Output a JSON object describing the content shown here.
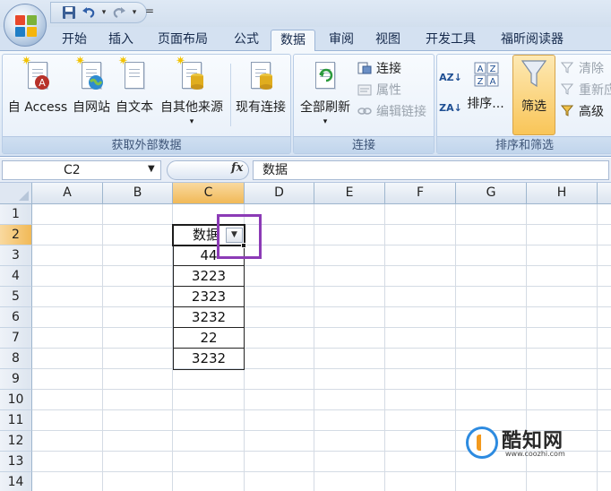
{
  "title_bar": {
    "qat_icons": [
      "save-icon",
      "undo-icon",
      "redo-icon"
    ],
    "qat_customize": "="
  },
  "tabs": [
    {
      "label": "开始"
    },
    {
      "label": "插入"
    },
    {
      "label": "页面布局"
    },
    {
      "label": "公式"
    },
    {
      "label": "数据",
      "active": true
    },
    {
      "label": "审阅"
    },
    {
      "label": "视图"
    },
    {
      "label": "开发工具"
    },
    {
      "label": "福昕阅读器"
    }
  ],
  "ribbon": {
    "external_data": {
      "label": "获取外部数据",
      "buttons": [
        "自 Access",
        "自网站",
        "自文本",
        "自其他来源",
        "现有连接"
      ]
    },
    "connections": {
      "label": "连接",
      "refresh_all": "全部刷新",
      "connections": "连接",
      "properties": "属性",
      "edit_links": "编辑链接"
    },
    "sort_filter": {
      "label": "排序和筛选",
      "sort_asc_icon": "AZ↓",
      "sort_desc_icon": "ZA↓",
      "sort": "排序...",
      "filter": "筛选",
      "clear": "清除",
      "reapply": "重新应",
      "advanced": "高级"
    }
  },
  "formula_bar": {
    "name_box": "C2",
    "fx": "fx",
    "formula": "数据"
  },
  "grid": {
    "columns": [
      "A",
      "B",
      "C",
      "D",
      "E",
      "F",
      "G",
      "H"
    ],
    "selected_column": "C",
    "rows": [
      "1",
      "2",
      "3",
      "4",
      "5",
      "6",
      "7",
      "8",
      "9",
      "10",
      "11",
      "12",
      "13",
      "14"
    ],
    "selected_row": "2",
    "column_c": [
      "",
      "数据",
      "44",
      "3223",
      "2323",
      "3232",
      "22",
      "3232"
    ]
  },
  "watermark": {
    "title": "酷知网",
    "url": "www.coozhi.com"
  },
  "colors": {
    "highlight": "#8c3bb6",
    "selected_header": "#f1b957",
    "ribbon_bg": "#dbe7f5"
  }
}
